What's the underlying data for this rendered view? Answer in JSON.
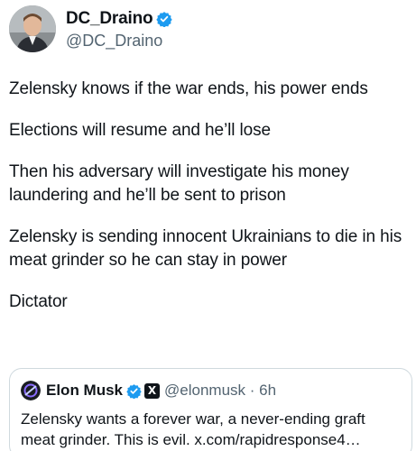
{
  "author": {
    "display_name": "DC_Draino",
    "handle": "@DC_Draino",
    "verified_color": "#1d9bf0"
  },
  "tweet": {
    "paragraphs": [
      "Zelensky knows if the war ends, his power ends",
      "Elections will resume and he’ll lose",
      "Then his adversary will investigate his money laundering and he’ll be sent to prison",
      "Zelensky is sending innocent Ukrainians to die in his meat grinder so he can stay in power",
      "Dictator"
    ]
  },
  "quoted": {
    "display_name": "Elon Musk",
    "handle_time": "@elonmusk · 6h",
    "x_badge": "X",
    "text": "Zelensky wants a forever war, a never-ending graft meat grinder. This is evil. x.com/rapidresponse4…"
  },
  "icons": {
    "verified": "verified-check-icon",
    "x_affiliation": "x-affiliation-icon"
  }
}
